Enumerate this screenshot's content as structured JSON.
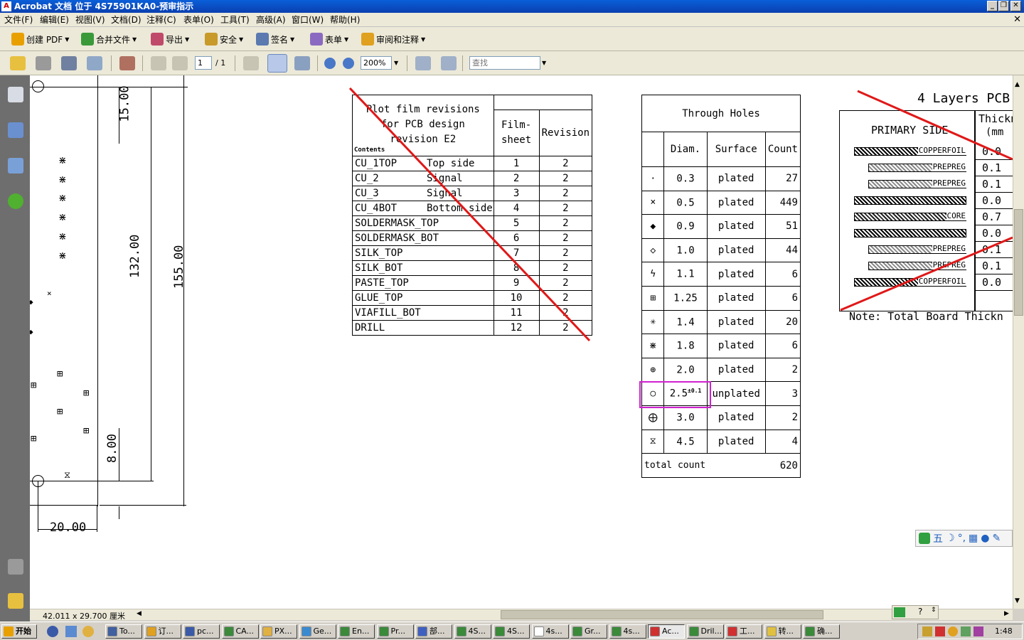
{
  "window": {
    "title": "Acrobat 文档 位于 4S75901KA0-预审指示",
    "controls": [
      "_",
      "❐",
      "✕"
    ]
  },
  "menu": [
    "文件(F)",
    "编辑(E)",
    "视图(V)",
    "文档(D)",
    "注释(C)",
    "表单(O)",
    "工具(T)",
    "高级(A)",
    "窗口(W)",
    "帮助(H)"
  ],
  "toolbar1": [
    "创建 PDF",
    "合并文件",
    "导出",
    "安全",
    "签名",
    "表单",
    "审阅和注释"
  ],
  "toolbar2": {
    "page_current": "1",
    "page_total": "/ 1",
    "zoom": "200%",
    "search_placeholder": "查找"
  },
  "status": {
    "page_size": "42.011 x 29.700 厘米"
  },
  "drawing": {
    "dim_15": "15.00",
    "dim_132": "132.00",
    "dim_155": "155.00",
    "dim_8": "8.00",
    "dim_20": "20.00"
  },
  "film_table": {
    "header": "Plot film revisions for PCB design revision E2",
    "contents_label": "Contents",
    "col_film": "Film-sheet",
    "col_rev": "Revision",
    "rows": [
      {
        "name": "CU_1TOP",
        "side": "Top side",
        "film": "1",
        "rev": "2"
      },
      {
        "name": "CU_2",
        "side": "Signal",
        "film": "2",
        "rev": "2"
      },
      {
        "name": "CU_3",
        "side": "Signal",
        "film": "3",
        "rev": "2"
      },
      {
        "name": "CU_4BOT",
        "side": "Bottom side",
        "film": "4",
        "rev": "2"
      },
      {
        "name": "SOLDERMASK_TOP",
        "side": "",
        "film": "5",
        "rev": "2"
      },
      {
        "name": "SOLDERMASK_BOT",
        "side": "",
        "film": "6",
        "rev": "2"
      },
      {
        "name": "SILK_TOP",
        "side": "",
        "film": "7",
        "rev": "2"
      },
      {
        "name": "SILK_BOT",
        "side": "",
        "film": "8",
        "rev": "2"
      },
      {
        "name": "PASTE_TOP",
        "side": "",
        "film": "9",
        "rev": "2"
      },
      {
        "name": "GLUE_TOP",
        "side": "",
        "film": "10",
        "rev": "2"
      },
      {
        "name": "VIAFILL_BOT",
        "side": "",
        "film": "11",
        "rev": "2"
      },
      {
        "name": "DRILL",
        "side": "",
        "film": "12",
        "rev": "2"
      }
    ]
  },
  "holes_table": {
    "title": "Through Holes",
    "headers": [
      "Diam.",
      "Surface",
      "Count"
    ],
    "rows": [
      {
        "sym": "·",
        "diam": "0.3",
        "sup": "",
        "surface": "plated",
        "count": "27"
      },
      {
        "sym": "×",
        "diam": "0.5",
        "sup": "",
        "surface": "plated",
        "count": "449"
      },
      {
        "sym": "◆",
        "diam": "0.9",
        "sup": "",
        "surface": "plated",
        "count": "51"
      },
      {
        "sym": "◇",
        "diam": "1.0",
        "sup": "",
        "surface": "plated",
        "count": "44"
      },
      {
        "sym": "ϟ",
        "diam": "1.1",
        "sup": "",
        "surface": "plated",
        "count": "6"
      },
      {
        "sym": "⊞",
        "diam": "1.25",
        "sup": "",
        "surface": "plated",
        "count": "6"
      },
      {
        "sym": "✳",
        "diam": "1.4",
        "sup": "",
        "surface": "plated",
        "count": "20"
      },
      {
        "sym": "⋇",
        "diam": "1.8",
        "sup": "",
        "surface": "plated",
        "count": "6"
      },
      {
        "sym": "⊕",
        "diam": "2.0",
        "sup": "",
        "surface": "plated",
        "count": "2"
      },
      {
        "sym": "○",
        "diam": "2.5",
        "sup": "±0.1",
        "surface": "unplated",
        "count": "3"
      },
      {
        "sym": "⨁",
        "diam": "3.0",
        "sup": "",
        "surface": "plated",
        "count": "2"
      },
      {
        "sym": "⧖",
        "diam": "4.5",
        "sup": "",
        "surface": "plated",
        "count": "4"
      }
    ],
    "total_label": "total count",
    "total_value": "620"
  },
  "layers": {
    "title": "4 Layers PCB",
    "primary": "PRIMARY SIDE",
    "thick_header": "Thickn",
    "thick_unit": "(mm",
    "items": [
      {
        "label": "COPPERFOIL",
        "value": "0.0"
      },
      {
        "label": "PREPREG",
        "value": "0.1"
      },
      {
        "label": "PREPREG",
        "value": "0.1"
      },
      {
        "label": "",
        "value": "0.0"
      },
      {
        "label": "CORE",
        "value": "0.7"
      },
      {
        "label": "",
        "value": "0.0"
      },
      {
        "label": "PREPREG",
        "value": "0.1"
      },
      {
        "label": "PREPREG",
        "value": "0.1"
      },
      {
        "label": "COPPERFOIL",
        "value": "0.0"
      }
    ],
    "note": "Note: Total Board Thickn"
  },
  "ime": {
    "wubi": "五"
  },
  "taskbar": {
    "start": "开始",
    "tasks": [
      "To...",
      "订...",
      "pc...",
      "CA...",
      "PX...",
      "Ge...",
      "En...",
      "Pr...",
      "部...",
      "4S...",
      "4S...",
      "4s...",
      "Gr...",
      "4s...",
      "Ac...",
      "Dril...",
      "工...",
      "转...",
      "确..."
    ],
    "clock": "1:48"
  },
  "colors": {
    "title": "#0a4fc8",
    "highlight": "#d020d0",
    "strike": "#e01818"
  }
}
